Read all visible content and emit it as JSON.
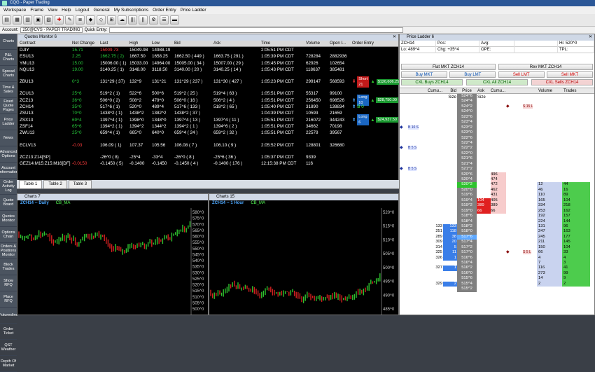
{
  "window": {
    "title": "CQG - Paper Trading"
  },
  "menu": [
    "Workspace",
    "Frame",
    "View",
    "Help",
    "Logout",
    "General",
    "My Subscriptions",
    "Order Entry",
    "Price Ladder"
  ],
  "account": {
    "label": "Account:",
    "value": "250@CVS - PAPER TRADING",
    "quick_entry_label": "Quick Entry:"
  },
  "sidebar": [
    "Charts",
    "P&L Charts",
    "Spread Charts",
    "Time & Sales",
    "Fixed Quote Pages",
    "Price Ladder",
    "News",
    "Advanced Options",
    "Account Information",
    "Order Activity Log",
    "Quote Board",
    "Quotes Monitor",
    "Options Chain",
    "Orders & Positions Monitor",
    "Block Trades",
    "Show RFQ",
    "Place RFQ",
    "Futuresline",
    "Order Ticket",
    "QST Weather",
    "Depth Of Market"
  ],
  "quotes": {
    "title": "Quotes Monitor 6",
    "headers": [
      "Contract",
      "Net Change",
      "Last",
      "High",
      "Low",
      "Bid",
      "Ask",
      "Time",
      "Volume",
      "Open I...",
      "Order Entry"
    ],
    "rows": [
      {
        "contract": "DJIY",
        "net": "15.71",
        "net_c": "green",
        "last": "15009.73",
        "last_c": "red",
        "high": "15049.98",
        "low": "14988.19",
        "bid": "",
        "ask": "",
        "time": "2:05:51 PM CDT",
        "vol": "",
        "oi": ""
      },
      {
        "contract": "ESU13",
        "net": "2.25",
        "net_c": "green",
        "last": "1662.75 ( 2)",
        "last_c": "green",
        "high": "1667.50",
        "low": "1658.25",
        "bid": "1662.50 ( 449 )",
        "ask": "1663.75 ( 291 )",
        "time": "1:05:39 PM CDT",
        "vol": "728284",
        "oi": "2882936"
      },
      {
        "contract": "YMU13",
        "net": "15.00",
        "net_c": "green",
        "last": "15006.00 ( 1)",
        "last_c": "",
        "high": "15033.00",
        "low": "14964.00",
        "bid": "15005.00 ( 34 )",
        "ask": "15007.00 ( 29 )",
        "time": "1:05:45 PM CDT",
        "vol": "62926",
        "oi": "102654"
      },
      {
        "contract": "NQU13",
        "net": "19.00",
        "net_c": "green",
        "last": "3140.25 ( 1)",
        "last_c": "",
        "high": "3148.00",
        "low": "3118.50",
        "bid": "3140.00 ( 20 )",
        "ask": "3140.25 ( 14 )",
        "time": "1:05:43 PM CDT",
        "vol": "118637",
        "oi": "385481"
      },
      {
        "blank": true
      },
      {
        "contract": "ZBU13",
        "net": "0^3",
        "net_c": "green",
        "last": "131^29 ( 37)",
        "last_c": "",
        "high": "132^9",
        "low": "131^21",
        "bid": "131^29 ( 237 )",
        "ask": "131^30 ( 427 )",
        "time": "1:05:23 PM CDT",
        "vol": "299147",
        "oi": "568593",
        "oe": "short",
        "oe_label": "Short 21",
        "oe_val": "$126,606.25"
      },
      {
        "blank": true
      },
      {
        "contract": "ZCU13",
        "net": "25^6",
        "net_c": "green",
        "last": "519^2 ( 1)",
        "last_c": "",
        "high": "522^6",
        "low": "500^6",
        "bid": "519^2 ( 25 )",
        "ask": "519^4 ( 63 )",
        "time": "1:05:51 PM CDT",
        "vol": "55317",
        "oi": "99100"
      },
      {
        "contract": "ZCZ13",
        "net": "36^0",
        "net_c": "green",
        "last": "506^0 ( 2)",
        "last_c": "",
        "high": "508^2",
        "low": "479^0",
        "bid": "506^0 ( 16 )",
        "ask": "506^2 ( 4 )",
        "time": "1:05:51 PM CDT",
        "vol": "256450",
        "oi": "698526",
        "oe": "long",
        "oe_label": "Long 10",
        "oe_val": "$28,750.00"
      },
      {
        "contract": "ZCH14",
        "net": "35^0",
        "net_c": "green",
        "last": "517^6 ( 1)",
        "last_c": "",
        "high": "520^0",
        "low": "489^4",
        "bid": "517^6 ( 133 )",
        "ask": "518^2 ( 65 )",
        "time": "1:05:40 PM CDT",
        "vol": "31890",
        "oi": "138834",
        "oe": "b0",
        "oe_label": "B 0"
      },
      {
        "contract": "ZSU13",
        "net": "70^0",
        "net_c": "green",
        "last": "1438^2 ( 1)",
        "last_c": "",
        "high": "1438^2",
        "low": "1382^2",
        "bid": "1438^2 ( 37 )",
        "ask": "",
        "time": "1:04:39 PM CDT",
        "vol": "10593",
        "oi": "21659"
      },
      {
        "contract": "ZSX13",
        "net": "69^4",
        "net_c": "green",
        "last": "1397^4 ( 1)",
        "last_c": "",
        "high": "1398^0",
        "low": "1348^0",
        "bid": "1397^4 ( 13 )",
        "ask": "1397^4 ( 11 )",
        "time": "1:05:51 PM CDT",
        "vol": "216072",
        "oi": "344243",
        "oe": "long",
        "oe_label": "Long 6",
        "oe_val": "$24,937.50"
      },
      {
        "contract": "ZSF14",
        "net": "65^6",
        "net_c": "green",
        "last": "1394^2 ( 1)",
        "last_c": "",
        "high": "1394^2",
        "low": "1344^2",
        "bid": "1394^2 ( 1 )",
        "ask": "1394^6 ( 2 )",
        "time": "1:05:51 PM CDT",
        "vol": "34662",
        "oi": "70198"
      },
      {
        "contract": "ZWU13",
        "net": "25^0",
        "net_c": "green",
        "last": "659^4 ( 1)",
        "last_c": "",
        "high": "665^0",
        "low": "640^0",
        "bid": "659^4 ( 24 )",
        "ask": "659^2 ( 32 )",
        "time": "1:05:51 PM CDT",
        "vol": "22578",
        "oi": "39567"
      },
      {
        "blank": true
      },
      {
        "contract": "ECLV13",
        "net": "-0.03",
        "net_c": "red",
        "last": "106.09 ( 1)",
        "last_c": "",
        "high": "107.37",
        "low": "105.56",
        "bid": "106.08 ( 7 )",
        "ask": "106.10 ( 9 )",
        "time": "2:05:52 PM CDT",
        "vol": "128801",
        "oi": "326680"
      },
      {
        "blank": true
      },
      {
        "contract": "ZCZ13:Z14[SP]",
        "net": "",
        "net_c": "",
        "last": "-26^0 ( 8)",
        "last_c": "",
        "high": "-25^4",
        "low": "-33^4",
        "bid": "-26^0 ( 8 )",
        "ask": "-25^6 ( 36 )",
        "time": "1:05:37 PM CDT",
        "vol": "9339",
        "oi": ""
      },
      {
        "contract": "GEZ14:M15:Z15:M16[DF]",
        "net": "-0.0150",
        "net_c": "red",
        "last": "-0.1450 ( 5)",
        "last_c": "",
        "high": "-0.1400",
        "low": "-0.1450",
        "bid": "-0.1450 ( 4 )",
        "ask": "-0.1400 ( 176 )",
        "time": "12:15:38 PM CDT",
        "vol": "116",
        "oi": ""
      }
    ]
  },
  "tabs": [
    "Table 1",
    "Table 2",
    "Table 3"
  ],
  "charts": [
    {
      "title": "Charts 7",
      "label": "ZCH14 -- Daily",
      "study": "CB_MA",
      "prices": [
        "580^0",
        "575^0",
        "570^0",
        "565^0",
        "560^0",
        "555^0",
        "550^0",
        "545^0",
        "540^0",
        "535^0",
        "530^0",
        "525^0",
        "520^0",
        "515^0",
        "510^0",
        "505^0",
        "500^0"
      ],
      "marker": "517^6"
    },
    {
      "title": "Charts 15",
      "label": "ZCH14 -- 1 Hour",
      "study": "CB_MA",
      "prices": [
        "520^0",
        "515^0",
        "510^0",
        "505^0",
        "500^0",
        "495^0",
        "490^0",
        "485^0"
      ]
    }
  ],
  "ladder": {
    "title": "Price Ladder 6",
    "symbol": "ZCH14",
    "info": {
      "pos_label": "Pos:",
      "avg_label": "Avg:",
      "hi_label": "Hi:",
      "hi": "520^0",
      "lo_label": "Lo:",
      "lo": "489^4",
      "chg_label": "Chg:",
      "chg": "+35^4",
      "ope_label": "OPE:",
      "tpl_label": "TPL:"
    },
    "buttons": {
      "flat": "Flat MKT ZCH14",
      "rev": "Rev MKT ZCH14",
      "buy_mkt": "Buy MKT",
      "buy_lmt": "Buy LMT",
      "sell_lmt": "Sell LMT",
      "sell_mkt": "Sell MKT",
      "cxl_buys": "CXL Buys ZCH14",
      "cxl_all": "CXL All ZCH14",
      "cxl_sells": "CXL Sells ZCH14"
    },
    "headers": [
      "Cumu...",
      "Bid Size",
      "Price",
      "Ask Size",
      "Cumu...",
      "",
      "Volume",
      "Trades"
    ],
    "rows": [
      {
        "price": "524^6"
      },
      {
        "price": "524^4"
      },
      {
        "price": "524^2",
        "sell": "S 15 L"
      },
      {
        "price": "524^0"
      },
      {
        "price": "523^6"
      },
      {
        "price": "523^4"
      },
      {
        "price": "523^2",
        "buy": "B 10 S"
      },
      {
        "price": "523^0"
      },
      {
        "price": "522^6"
      },
      {
        "price": "522^4"
      },
      {
        "price": "522^2",
        "buy": "B 5 S"
      },
      {
        "price": "522^0"
      },
      {
        "price": "521^6"
      },
      {
        "price": "521^4"
      },
      {
        "price": "521^2",
        "buy": "B 5 S"
      },
      {
        "price": "520^6",
        "ask": "",
        "cum": "496"
      },
      {
        "price": "520^4",
        "cum": "474"
      },
      {
        "price": "520^2",
        "cum": "472",
        "hi": true,
        "vol": "12",
        "tr": "44"
      },
      {
        "price": "520^0",
        "cum": "462",
        "vol": "46",
        "tr": "16"
      },
      {
        "price": "519^6",
        "cum": "431",
        "vol": "110",
        "tr": "89"
      },
      {
        "price": "519^4",
        "ask": "104",
        "cum": "405",
        "vol": "165",
        "tr": "104"
      },
      {
        "price": "519^2",
        "ask": "389",
        "cum": "389",
        "vol": "334",
        "tr": "218"
      },
      {
        "price": "519^0",
        "ask": "66",
        "cum": "66",
        "vol": "253",
        "tr": "162"
      },
      {
        "price": "518^6",
        "vol": "192",
        "tr": "157"
      },
      {
        "price": "518^4",
        "vol": "224",
        "tr": "144"
      },
      {
        "price": "518^2",
        "cum": "133",
        "bid": "133",
        "vol": "131",
        "tr": "96"
      },
      {
        "price": "518^0",
        "cum": "251",
        "bid": "118",
        "vol": "247",
        "tr": "163"
      },
      {
        "price": "517^6",
        "cum": "289",
        "bid": "38",
        "last": true,
        "vol": "245",
        "tr": "177"
      },
      {
        "price": "517^4",
        "cum": "309",
        "bid": "20",
        "vol": "211",
        "tr": "145"
      },
      {
        "price": "517^2",
        "cum": "314",
        "bid": "5",
        "vol": "150",
        "tr": "104"
      },
      {
        "price": "517^0",
        "cum": "325",
        "bid": "11",
        "sell": "S 5 L",
        "vol": "66",
        "tr": "33"
      },
      {
        "price": "516^6",
        "cum": "326",
        "bid": "1",
        "vol": "4",
        "tr": "4"
      },
      {
        "price": "516^4",
        "vol": "7",
        "tr": "3"
      },
      {
        "price": "516^2",
        "cum": "327",
        "bid": "1",
        "vol": "116",
        "tr": "41"
      },
      {
        "price": "516^0",
        "vol": "273",
        "tr": "99"
      },
      {
        "price": "515^6",
        "vol": "14",
        "tr": "9"
      },
      {
        "price": "515^4",
        "cum": "329",
        "bid": "2",
        "vol": "2",
        "tr": "2"
      },
      {
        "price": "515^2"
      }
    ]
  }
}
